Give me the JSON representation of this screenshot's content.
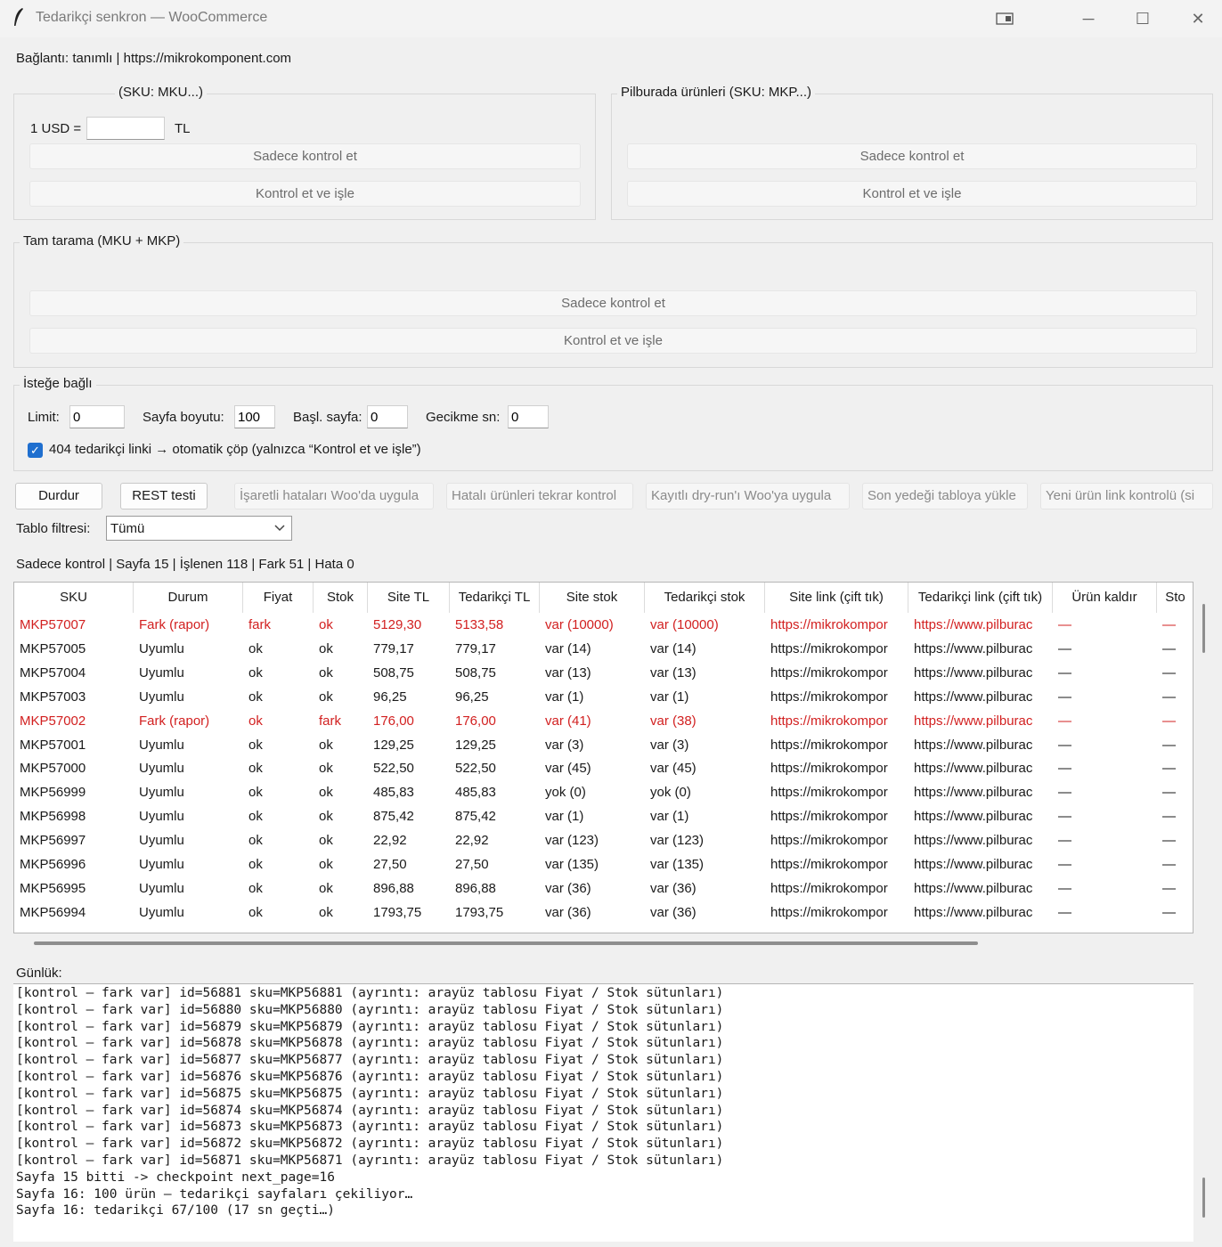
{
  "window": {
    "title": "Tedarikçi senkron — WooCommerce"
  },
  "connection_text": "Bağlantı: tanımlı | https://mikrokomponent.com",
  "group_mku": {
    "label": "(SKU: MKU...)",
    "usd_label": "1 USD =",
    "usd_value": "",
    "tl_label": "TL",
    "check_only": "Sadece kontrol et",
    "check_process": "Kontrol et ve işle"
  },
  "group_mkp": {
    "label": "Pilburada ürünleri (SKU: MKP...)",
    "check_only": "Sadece kontrol et",
    "check_process": "Kontrol et ve işle"
  },
  "group_full": {
    "label": "Tam tarama (MKU + MKP)",
    "check_only": "Sadece kontrol et",
    "check_process": "Kontrol et ve işle"
  },
  "group_optional": {
    "label": "İsteğe bağlı",
    "limit_label": "Limit:",
    "limit_value": "0",
    "page_size_label": "Sayfa boyutu:",
    "page_size_value": "100",
    "start_page_label": "Başl. sayfa:",
    "start_page_value": "0",
    "delay_label": "Gecikme sn:",
    "delay_value": "0",
    "auto_trash_label": "404 tedarikçi linki → otomatik çöp (yalnızca “Kontrol et ve işle”)",
    "auto_trash_checked": true
  },
  "actions": {
    "stop": "Durdur",
    "rest_test": "REST testi",
    "apply_marked": "İşaretli hataları Woo'da uygula",
    "recheck_errors": "Hatalı ürünleri tekrar kontrol",
    "apply_dryrun": "Kayıtlı dry-run'ı Woo'ya uygula",
    "load_backup": "Son yedeği tabloya yükle",
    "new_product_link": "Yeni ürün link kontrolü (si"
  },
  "filter": {
    "label": "Tablo filtresi:",
    "value": "Tümü"
  },
  "status_text": "Sadece kontrol | Sayfa 15 | İşlenen 118 | Fark 51 | Hata 0",
  "table": {
    "columns": [
      "SKU",
      "Durum",
      "Fiyat",
      "Stok",
      "Site TL",
      "Tedarikçi TL",
      "Site stok",
      "Tedarikçi stok",
      "Site link (çift tık)",
      "Tedarikçi link (çift tık)",
      "Ürün kaldır",
      "Sto"
    ],
    "rows": [
      {
        "highlight": true,
        "cells": [
          "MKP57007",
          "Fark (rapor)",
          "fark",
          "ok",
          "5129,30",
          "5133,58",
          "var (10000)",
          "var (10000)",
          "https://mikrokompor",
          "https://www.pilburac",
          "—",
          "—"
        ]
      },
      {
        "highlight": false,
        "cells": [
          "MKP57005",
          "Uyumlu",
          "ok",
          "ok",
          "779,17",
          "779,17",
          "var (14)",
          "var (14)",
          "https://mikrokompor",
          "https://www.pilburac",
          "—",
          "—"
        ]
      },
      {
        "highlight": false,
        "cells": [
          "MKP57004",
          "Uyumlu",
          "ok",
          "ok",
          "508,75",
          "508,75",
          "var (13)",
          "var (13)",
          "https://mikrokompor",
          "https://www.pilburac",
          "—",
          "—"
        ]
      },
      {
        "highlight": false,
        "cells": [
          "MKP57003",
          "Uyumlu",
          "ok",
          "ok",
          "96,25",
          "96,25",
          "var (1)",
          "var (1)",
          "https://mikrokompor",
          "https://www.pilburac",
          "—",
          "—"
        ]
      },
      {
        "highlight": true,
        "cells": [
          "MKP57002",
          "Fark (rapor)",
          "ok",
          "fark",
          "176,00",
          "176,00",
          "var (41)",
          "var (38)",
          "https://mikrokompor",
          "https://www.pilburac",
          "—",
          "—"
        ]
      },
      {
        "highlight": false,
        "cells": [
          "MKP57001",
          "Uyumlu",
          "ok",
          "ok",
          "129,25",
          "129,25",
          "var (3)",
          "var (3)",
          "https://mikrokompor",
          "https://www.pilburac",
          "—",
          "—"
        ]
      },
      {
        "highlight": false,
        "cells": [
          "MKP57000",
          "Uyumlu",
          "ok",
          "ok",
          "522,50",
          "522,50",
          "var (45)",
          "var (45)",
          "https://mikrokompor",
          "https://www.pilburac",
          "—",
          "—"
        ]
      },
      {
        "highlight": false,
        "cells": [
          "MKP56999",
          "Uyumlu",
          "ok",
          "ok",
          "485,83",
          "485,83",
          "yok (0)",
          "yok (0)",
          "https://mikrokompor",
          "https://www.pilburac",
          "—",
          "—"
        ]
      },
      {
        "highlight": false,
        "cells": [
          "MKP56998",
          "Uyumlu",
          "ok",
          "ok",
          "875,42",
          "875,42",
          "var (1)",
          "var (1)",
          "https://mikrokompor",
          "https://www.pilburac",
          "—",
          "—"
        ]
      },
      {
        "highlight": false,
        "cells": [
          "MKP56997",
          "Uyumlu",
          "ok",
          "ok",
          "22,92",
          "22,92",
          "var (123)",
          "var (123)",
          "https://mikrokompor",
          "https://www.pilburac",
          "—",
          "—"
        ]
      },
      {
        "highlight": false,
        "cells": [
          "MKP56996",
          "Uyumlu",
          "ok",
          "ok",
          "27,50",
          "27,50",
          "var (135)",
          "var (135)",
          "https://mikrokompor",
          "https://www.pilburac",
          "—",
          "—"
        ]
      },
      {
        "highlight": false,
        "cells": [
          "MKP56995",
          "Uyumlu",
          "ok",
          "ok",
          "896,88",
          "896,88",
          "var (36)",
          "var (36)",
          "https://mikrokompor",
          "https://www.pilburac",
          "—",
          "—"
        ]
      },
      {
        "highlight": false,
        "cells": [
          "MKP56994",
          "Uyumlu",
          "ok",
          "ok",
          "1793,75",
          "1793,75",
          "var (36)",
          "var (36)",
          "https://mikrokompor",
          "https://www.pilburac",
          "—",
          "—"
        ]
      }
    ]
  },
  "log": {
    "label": "Günlük:",
    "lines": [
      "[kontrol – fark var] id=56881 sku=MKP56881 (ayrıntı: arayüz tablosu Fiyat / Stok sütunları)",
      "[kontrol – fark var] id=56880 sku=MKP56880 (ayrıntı: arayüz tablosu Fiyat / Stok sütunları)",
      "[kontrol – fark var] id=56879 sku=MKP56879 (ayrıntı: arayüz tablosu Fiyat / Stok sütunları)",
      "[kontrol – fark var] id=56878 sku=MKP56878 (ayrıntı: arayüz tablosu Fiyat / Stok sütunları)",
      "[kontrol – fark var] id=56877 sku=MKP56877 (ayrıntı: arayüz tablosu Fiyat / Stok sütunları)",
      "[kontrol – fark var] id=56876 sku=MKP56876 (ayrıntı: arayüz tablosu Fiyat / Stok sütunları)",
      "[kontrol – fark var] id=56875 sku=MKP56875 (ayrıntı: arayüz tablosu Fiyat / Stok sütunları)",
      "[kontrol – fark var] id=56874 sku=MKP56874 (ayrıntı: arayüz tablosu Fiyat / Stok sütunları)",
      "[kontrol – fark var] id=56873 sku=MKP56873 (ayrıntı: arayüz tablosu Fiyat / Stok sütunları)",
      "[kontrol – fark var] id=56872 sku=MKP56872 (ayrıntı: arayüz tablosu Fiyat / Stok sütunları)",
      "[kontrol – fark var] id=56871 sku=MKP56871 (ayrıntı: arayüz tablosu Fiyat / Stok sütunları)",
      "Sayfa 15 bitti -> checkpoint next_page=16",
      "Sayfa 16: 100 ürün – tedarikçi sayfaları çekiliyor…",
      "Sayfa 16: tedarikçi 67/100 (17 sn geçti…)"
    ]
  },
  "colors": {
    "highlight_red": "#d22020",
    "checkbox_blue": "#1f6fcf"
  },
  "icons": [
    "feather-icon",
    "snap-layout-icon",
    "minimize-icon",
    "maximize-icon",
    "close-icon",
    "chevron-down-icon",
    "checkmark-icon"
  ]
}
